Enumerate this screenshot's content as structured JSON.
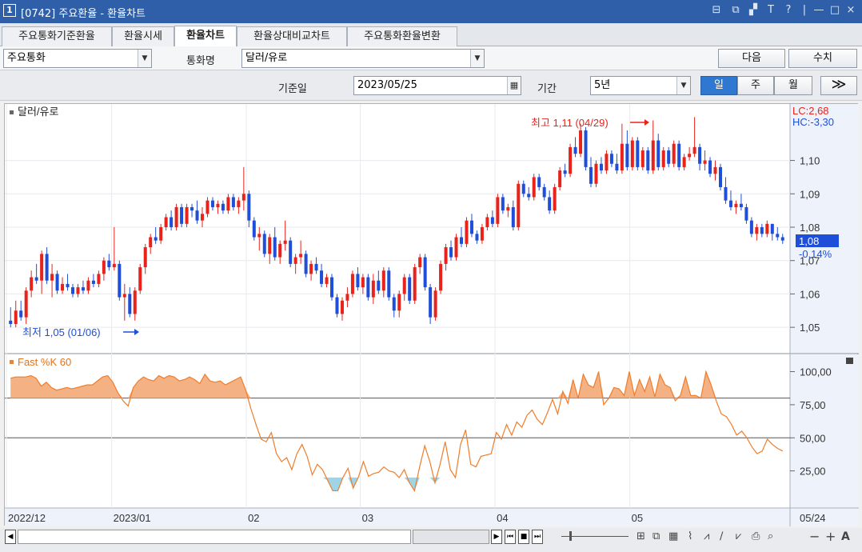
{
  "window": {
    "number": "1",
    "title": "[0742] 주요환율 - 환율차트",
    "controls": [
      "⊟",
      "⧉",
      "▞",
      "T",
      "?",
      "|",
      "—",
      "□",
      "×"
    ]
  },
  "tabs": [
    {
      "label": "주요통화기준환율",
      "active": false
    },
    {
      "label": "환율시세",
      "active": false
    },
    {
      "label": "환율차트",
      "active": true
    },
    {
      "label": "환율상대비교차트",
      "active": false
    },
    {
      "label": "주요통화환율변환",
      "active": false
    }
  ],
  "filters": {
    "category": "주요통화",
    "currency_label": "통화명",
    "currency": "달러/유로",
    "next_label": "다음",
    "numeric_label": "수치"
  },
  "query": {
    "date_label": "기준일",
    "date": "2023/05/25",
    "period_label": "기간",
    "period": "5년",
    "unit_day": "일",
    "unit_week": "주",
    "unit_month": "월",
    "unit_active": "일",
    "expand_icon": "double-chevron-right-icon"
  },
  "chart": {
    "series_name": "달러/유로",
    "indicator_name": "Fast %K 60",
    "lc_label": "LC:2,68",
    "hc_label": "HC:-3,30",
    "high_annotation": "최고 1,11 (04/29)",
    "low_annotation": "최저 1,05 (01/06)",
    "current_price": "1,08",
    "current_change": "-0,14%",
    "up_color": "#e8231c",
    "down_color": "#1f4fd8",
    "osc_color": "#f07d2a",
    "osc_fill": "#f4b183",
    "osc_low_fill": "#9fd3e6"
  },
  "chart_data": [
    {
      "type": "candlestick",
      "title": "달러/유로",
      "ylim": [
        1.045,
        1.115
      ],
      "y_ticks": [
        "1,10",
        "1,09",
        "1,08",
        "1,07",
        "1,06",
        "1,05"
      ],
      "x_ticks": [
        "2022/12",
        "2023/01",
        "02",
        "03",
        "04",
        "05",
        "05/24"
      ],
      "ohlc": [
        [
          1.052,
          1.056,
          1.05,
          1.051
        ],
        [
          1.051,
          1.058,
          1.05,
          1.055
        ],
        [
          1.055,
          1.058,
          1.052,
          1.053
        ],
        [
          1.053,
          1.062,
          1.051,
          1.061
        ],
        [
          1.061,
          1.067,
          1.059,
          1.065
        ],
        [
          1.065,
          1.069,
          1.063,
          1.064
        ],
        [
          1.064,
          1.073,
          1.06,
          1.072
        ],
        [
          1.072,
          1.074,
          1.063,
          1.064
        ],
        [
          1.064,
          1.069,
          1.059,
          1.066
        ],
        [
          1.066,
          1.067,
          1.06,
          1.061
        ],
        [
          1.061,
          1.065,
          1.06,
          1.063
        ],
        [
          1.063,
          1.066,
          1.061,
          1.062
        ],
        [
          1.062,
          1.063,
          1.059,
          1.06
        ],
        [
          1.06,
          1.063,
          1.059,
          1.062
        ],
        [
          1.062,
          1.064,
          1.06,
          1.061
        ],
        [
          1.061,
          1.065,
          1.06,
          1.064
        ],
        [
          1.064,
          1.066,
          1.062,
          1.063
        ],
        [
          1.063,
          1.067,
          1.062,
          1.066
        ],
        [
          1.066,
          1.071,
          1.064,
          1.07
        ],
        [
          1.07,
          1.072,
          1.067,
          1.068
        ],
        [
          1.068,
          1.08,
          1.067,
          1.069
        ],
        [
          1.069,
          1.07,
          1.058,
          1.059
        ],
        [
          1.059,
          1.063,
          1.052,
          1.06
        ],
        [
          1.06,
          1.062,
          1.053,
          1.054
        ],
        [
          1.054,
          1.062,
          1.052,
          1.061
        ],
        [
          1.061,
          1.069,
          1.06,
          1.068
        ],
        [
          1.068,
          1.075,
          1.066,
          1.074
        ],
        [
          1.074,
          1.078,
          1.072,
          1.077
        ],
        [
          1.077,
          1.08,
          1.075,
          1.076
        ],
        [
          1.076,
          1.081,
          1.075,
          1.08
        ],
        [
          1.08,
          1.084,
          1.079,
          1.083
        ],
        [
          1.083,
          1.085,
          1.079,
          1.08
        ],
        [
          1.08,
          1.087,
          1.079,
          1.086
        ],
        [
          1.086,
          1.087,
          1.08,
          1.081
        ],
        [
          1.081,
          1.087,
          1.08,
          1.086
        ],
        [
          1.086,
          1.087,
          1.083,
          1.085
        ],
        [
          1.085,
          1.088,
          1.081,
          1.082
        ],
        [
          1.082,
          1.086,
          1.08,
          1.084
        ],
        [
          1.084,
          1.089,
          1.083,
          1.088
        ],
        [
          1.088,
          1.089,
          1.085,
          1.086
        ],
        [
          1.086,
          1.088,
          1.084,
          1.087
        ],
        [
          1.087,
          1.088,
          1.084,
          1.085
        ],
        [
          1.085,
          1.09,
          1.084,
          1.089
        ],
        [
          1.089,
          1.09,
          1.085,
          1.086
        ],
        [
          1.086,
          1.089,
          1.084,
          1.088
        ],
        [
          1.088,
          1.098,
          1.085,
          1.09
        ],
        [
          1.09,
          1.091,
          1.08,
          1.082
        ],
        [
          1.082,
          1.083,
          1.076,
          1.077
        ],
        [
          1.077,
          1.08,
          1.073,
          1.078
        ],
        [
          1.078,
          1.079,
          1.071,
          1.072
        ],
        [
          1.072,
          1.078,
          1.069,
          1.077
        ],
        [
          1.077,
          1.08,
          1.07,
          1.071
        ],
        [
          1.071,
          1.076,
          1.069,
          1.075
        ],
        [
          1.075,
          1.082,
          1.073,
          1.076
        ],
        [
          1.076,
          1.077,
          1.068,
          1.069
        ],
        [
          1.069,
          1.072,
          1.066,
          1.071
        ],
        [
          1.071,
          1.076,
          1.069,
          1.072
        ],
        [
          1.072,
          1.073,
          1.065,
          1.066
        ],
        [
          1.066,
          1.07,
          1.064,
          1.069
        ],
        [
          1.069,
          1.071,
          1.066,
          1.067
        ],
        [
          1.067,
          1.069,
          1.062,
          1.063
        ],
        [
          1.063,
          1.066,
          1.062,
          1.065
        ],
        [
          1.065,
          1.066,
          1.058,
          1.059
        ],
        [
          1.059,
          1.06,
          1.053,
          1.054
        ],
        [
          1.054,
          1.059,
          1.052,
          1.058
        ],
        [
          1.058,
          1.062,
          1.056,
          1.06
        ],
        [
          1.06,
          1.067,
          1.059,
          1.066
        ],
        [
          1.066,
          1.068,
          1.061,
          1.062
        ],
        [
          1.062,
          1.066,
          1.06,
          1.065
        ],
        [
          1.065,
          1.066,
          1.058,
          1.059
        ],
        [
          1.059,
          1.066,
          1.057,
          1.064
        ],
        [
          1.064,
          1.067,
          1.06,
          1.061
        ],
        [
          1.061,
          1.068,
          1.059,
          1.067
        ],
        [
          1.067,
          1.068,
          1.058,
          1.059
        ],
        [
          1.059,
          1.06,
          1.053,
          1.055
        ],
        [
          1.055,
          1.061,
          1.053,
          1.06
        ],
        [
          1.06,
          1.066,
          1.058,
          1.065
        ],
        [
          1.065,
          1.066,
          1.057,
          1.058
        ],
        [
          1.058,
          1.069,
          1.057,
          1.068
        ],
        [
          1.068,
          1.072,
          1.066,
          1.071
        ],
        [
          1.071,
          1.072,
          1.061,
          1.062
        ],
        [
          1.062,
          1.063,
          1.051,
          1.053
        ],
        [
          1.053,
          1.062,
          1.052,
          1.061
        ],
        [
          1.061,
          1.07,
          1.06,
          1.069
        ],
        [
          1.069,
          1.075,
          1.067,
          1.074
        ],
        [
          1.074,
          1.076,
          1.07,
          1.071
        ],
        [
          1.071,
          1.078,
          1.07,
          1.077
        ],
        [
          1.077,
          1.08,
          1.074,
          1.075
        ],
        [
          1.075,
          1.083,
          1.074,
          1.082
        ],
        [
          1.082,
          1.084,
          1.077,
          1.078
        ],
        [
          1.078,
          1.079,
          1.075,
          1.076
        ],
        [
          1.076,
          1.081,
          1.075,
          1.08
        ],
        [
          1.08,
          1.084,
          1.079,
          1.083
        ],
        [
          1.083,
          1.085,
          1.08,
          1.081
        ],
        [
          1.081,
          1.09,
          1.08,
          1.089
        ],
        [
          1.089,
          1.09,
          1.084,
          1.085
        ],
        [
          1.085,
          1.087,
          1.083,
          1.086
        ],
        [
          1.086,
          1.088,
          1.079,
          1.08
        ],
        [
          1.08,
          1.094,
          1.079,
          1.093
        ],
        [
          1.093,
          1.094,
          1.089,
          1.09
        ],
        [
          1.09,
          1.092,
          1.088,
          1.089
        ],
        [
          1.089,
          1.096,
          1.088,
          1.095
        ],
        [
          1.095,
          1.096,
          1.091,
          1.092
        ],
        [
          1.092,
          1.093,
          1.088,
          1.089
        ],
        [
          1.089,
          1.091,
          1.084,
          1.085
        ],
        [
          1.085,
          1.093,
          1.084,
          1.092
        ],
        [
          1.092,
          1.098,
          1.091,
          1.097
        ],
        [
          1.097,
          1.099,
          1.095,
          1.096
        ],
        [
          1.096,
          1.105,
          1.095,
          1.104
        ],
        [
          1.104,
          1.107,
          1.101,
          1.102
        ],
        [
          1.102,
          1.111,
          1.101,
          1.109
        ],
        [
          1.109,
          1.11,
          1.097,
          1.098
        ],
        [
          1.098,
          1.101,
          1.092,
          1.093
        ],
        [
          1.093,
          1.1,
          1.092,
          1.099
        ],
        [
          1.099,
          1.101,
          1.096,
          1.097
        ],
        [
          1.097,
          1.103,
          1.096,
          1.102
        ],
        [
          1.102,
          1.103,
          1.098,
          1.099
        ],
        [
          1.099,
          1.102,
          1.096,
          1.097
        ],
        [
          1.097,
          1.111,
          1.096,
          1.105
        ],
        [
          1.105,
          1.109,
          1.097,
          1.098
        ],
        [
          1.098,
          1.107,
          1.097,
          1.106
        ],
        [
          1.106,
          1.107,
          1.097,
          1.098
        ],
        [
          1.098,
          1.104,
          1.097,
          1.103
        ],
        [
          1.103,
          1.104,
          1.096,
          1.097
        ],
        [
          1.097,
          1.112,
          1.096,
          1.106
        ],
        [
          1.106,
          1.108,
          1.097,
          1.098
        ],
        [
          1.098,
          1.104,
          1.097,
          1.103
        ],
        [
          1.103,
          1.104,
          1.098,
          1.099
        ],
        [
          1.099,
          1.106,
          1.098,
          1.105
        ],
        [
          1.105,
          1.106,
          1.097,
          1.098
        ],
        [
          1.098,
          1.102,
          1.097,
          1.101
        ],
        [
          1.101,
          1.104,
          1.1,
          1.102
        ],
        [
          1.102,
          1.113,
          1.101,
          1.104
        ],
        [
          1.104,
          1.105,
          1.097,
          1.099
        ],
        [
          1.099,
          1.103,
          1.097,
          1.1
        ],
        [
          1.1,
          1.101,
          1.095,
          1.096
        ],
        [
          1.096,
          1.1,
          1.094,
          1.098
        ],
        [
          1.098,
          1.099,
          1.091,
          1.092
        ],
        [
          1.092,
          1.095,
          1.087,
          1.088
        ],
        [
          1.088,
          1.091,
          1.085,
          1.086
        ],
        [
          1.086,
          1.088,
          1.084,
          1.087
        ],
        [
          1.087,
          1.09,
          1.085,
          1.086
        ],
        [
          1.086,
          1.087,
          1.081,
          1.082
        ],
        [
          1.082,
          1.083,
          1.077,
          1.078
        ],
        [
          1.078,
          1.081,
          1.076,
          1.08
        ],
        [
          1.08,
          1.081,
          1.077,
          1.078
        ],
        [
          1.078,
          1.082,
          1.077,
          1.081
        ],
        [
          1.081,
          1.081,
          1.076,
          1.078
        ],
        [
          1.078,
          1.08,
          1.076,
          1.077
        ],
        [
          1.077,
          1.078,
          1.075,
          1.076
        ]
      ]
    },
    {
      "type": "line",
      "title": "Fast %K 60",
      "ylim": [
        0,
        110
      ],
      "y_ticks": [
        "100,00",
        "75,00",
        "50,00",
        "25,00"
      ],
      "reference_lines": [
        80,
        50
      ],
      "values": [
        95,
        96,
        96,
        96,
        97,
        95,
        89,
        92,
        88,
        86,
        87,
        88,
        87,
        88,
        89,
        90,
        90,
        93,
        96,
        97,
        92,
        84,
        78,
        74,
        88,
        93,
        96,
        94,
        93,
        97,
        95,
        97,
        96,
        93,
        94,
        96,
        94,
        91,
        98,
        93,
        92,
        93,
        90,
        92,
        94,
        96,
        86,
        72,
        60,
        49,
        47,
        54,
        38,
        32,
        35,
        26,
        38,
        45,
        36,
        22,
        30,
        26,
        18,
        10,
        10,
        20,
        27,
        12,
        20,
        32,
        21,
        23,
        24,
        28,
        25,
        24,
        20,
        26,
        16,
        10,
        28,
        44,
        32,
        16,
        30,
        47,
        26,
        20,
        45,
        56,
        30,
        28,
        36,
        37,
        38,
        54,
        49,
        60,
        52,
        62,
        58,
        67,
        71,
        64,
        60,
        69,
        79,
        68,
        85,
        76,
        94,
        80,
        98,
        90,
        88,
        100,
        75,
        80,
        88,
        87,
        82,
        100,
        82,
        94,
        85,
        96,
        81,
        98,
        90,
        88,
        78,
        82,
        96,
        82,
        82,
        80,
        100,
        90,
        78,
        68,
        66,
        60,
        52,
        55,
        50,
        43,
        38,
        40,
        49,
        45,
        42,
        40
      ]
    }
  ],
  "bottom_toolbar": {
    "play_icons": [
      "play-icon",
      "first-icon",
      "stop-icon",
      "last-icon"
    ],
    "tool_icons": [
      "crosshair-icon",
      "window-icon",
      "grid-icon",
      "line-icon",
      "trend-icon",
      "draw-icon",
      "shape-icon",
      "save-icon",
      "zoom-icon"
    ],
    "zoom_out_label": "−",
    "zoom_in_label": "+",
    "auto_label": "A"
  }
}
